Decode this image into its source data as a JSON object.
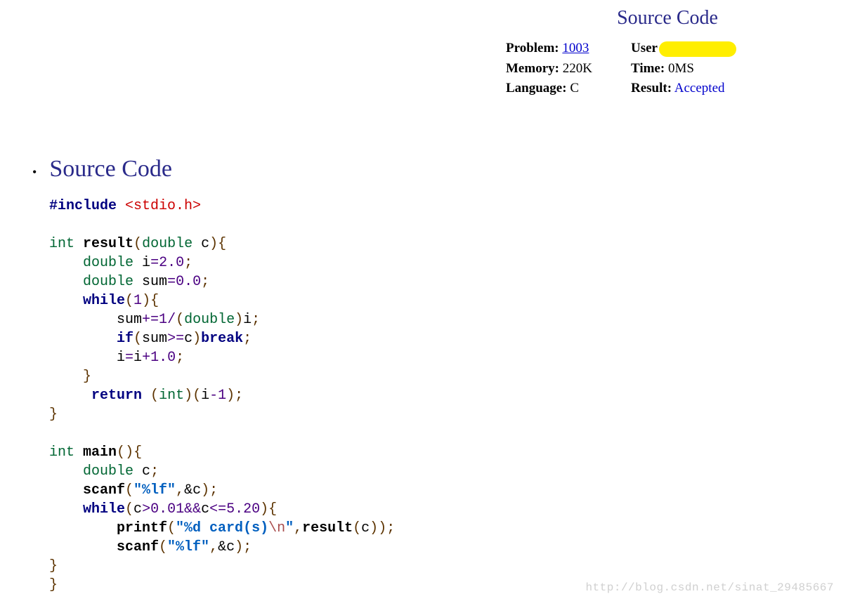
{
  "header": {
    "title": "Source Code",
    "problem_label": "Problem:",
    "problem_link": "1003",
    "user_label": "User",
    "memory_label": "Memory:",
    "memory_value": "220K",
    "time_label": "Time:",
    "time_value": "0MS",
    "language_label": "Language:",
    "language_value": "C",
    "result_label": "Result:",
    "result_value": "Accepted"
  },
  "section": {
    "title": "Source Code"
  },
  "code": {
    "include_kw": "#include",
    "include_hdr": "<stdio.h>",
    "int": "int",
    "double": "double",
    "result_fn": "result",
    "main_fn": "main",
    "scanf_fn": "scanf",
    "printf_fn": "printf",
    "while_kw": "while",
    "if_kw": "if",
    "break_kw": "break",
    "return_kw": "return",
    "var_c": "c",
    "var_i": "i",
    "var_sum": "sum",
    "num_2_0": "2.0",
    "num_0_0": "0.0",
    "num_1": "1",
    "num_1_0": "1.0",
    "num_0_01": "0.01",
    "num_5_20": "5.20",
    "str_lf": "\"%lf\"",
    "str_card_a": "\"%d card(s)",
    "str_card_nl": "\\n",
    "str_card_b": "\"",
    "amp_c": "&c",
    "cast_double": "double",
    "cast_int": "int"
  },
  "watermark": "http://blog.csdn.net/sinat_29485667"
}
